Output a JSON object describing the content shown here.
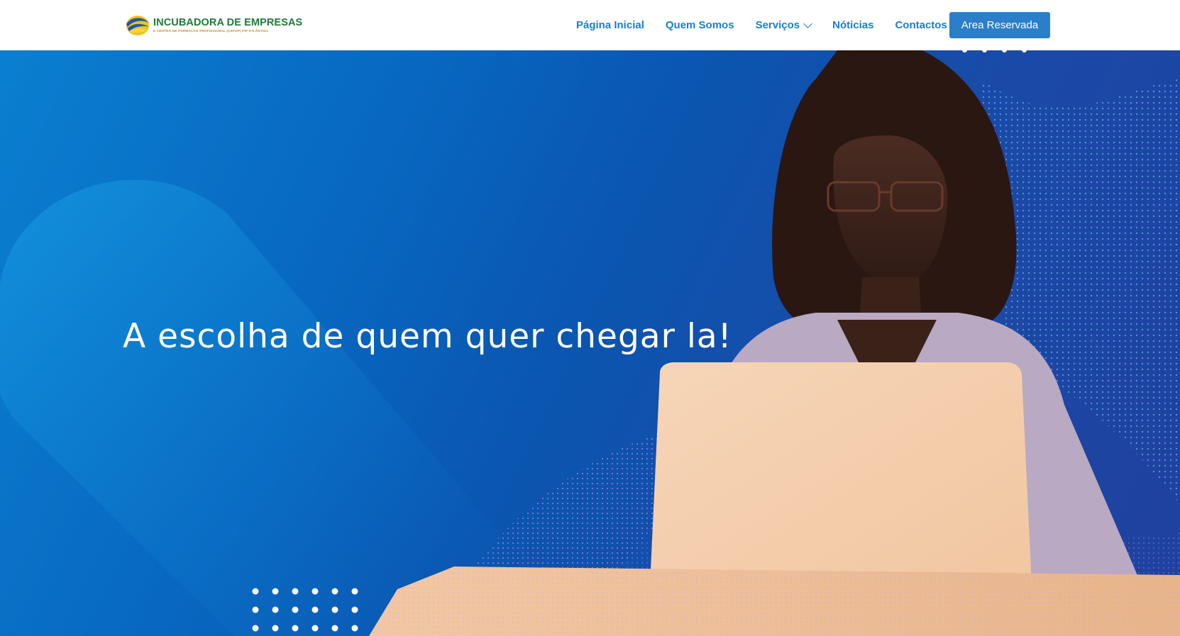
{
  "header": {
    "logo": {
      "title": "INCUBADORA DE EMPRESAS",
      "subtitle": "E CENTRO DE FORMAÇÃO PROFISSIONAL (CEFOP) FIP-ATLÂNTIDA"
    },
    "nav": [
      {
        "label": "Página Inicial"
      },
      {
        "label": "Quem Somos"
      },
      {
        "label": "Serviços",
        "dropdown_icon": "chevron-down-icon"
      },
      {
        "label": "Nóticias"
      },
      {
        "label": "Contactos"
      }
    ],
    "cta_label": "Area Reservada"
  },
  "hero": {
    "headline": "A escolha de quem quer chegar la!"
  },
  "colors": {
    "nav_text": "#1a7fc8",
    "cta_bg": "#2a7fc8",
    "logo_green": "#1f7a3a",
    "logo_gold": "#c98a12",
    "hero_blue": "#0a56b0"
  }
}
